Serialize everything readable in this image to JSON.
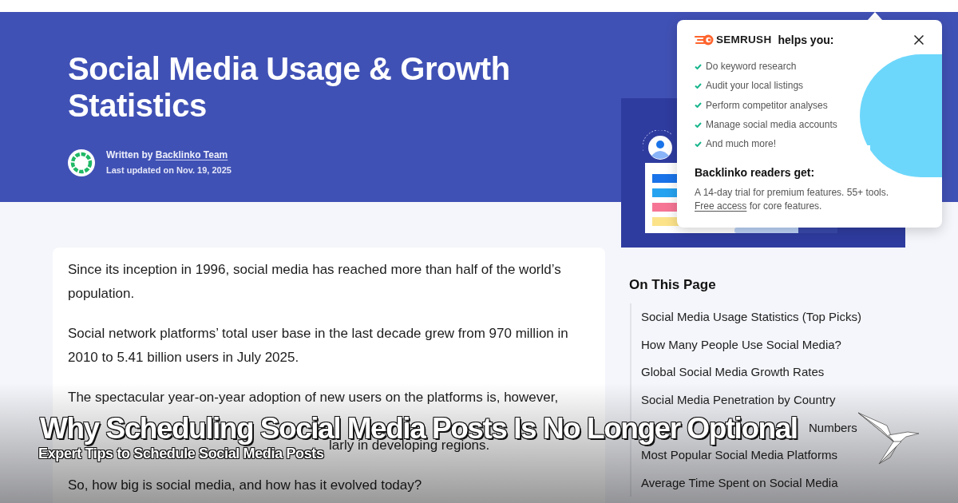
{
  "header": {
    "title": "Social Media Usage & Growth Statistics",
    "byline_label": "Written by",
    "author": "Backlinko Team",
    "updated": "Last updated on Nov. 19, 2025"
  },
  "article": {
    "paragraphs": [
      {
        "kind": "full",
        "text": "Since its inception in 1996, social media has reached more than half of the world’s population."
      },
      {
        "kind": "full",
        "text": "Social network platforms’ total user base in the last decade grew from 970 million in 2010 to 5.41 billion users in July 2025."
      },
      {
        "kind": "covered",
        "lines": [
          "The spectacular year-on-year adoption of new users on the platforms is, however,",
          "larly in developing regions."
        ]
      },
      {
        "kind": "full",
        "text": "So, how big is social media, and how has it evolved today?"
      }
    ]
  },
  "sidebar": {
    "toc_heading": "On This Page",
    "toc_items": [
      {
        "kind": "full",
        "text": "Social Media Usage Statistics (Top Picks)"
      },
      {
        "kind": "full",
        "text": "How Many People Use Social Media?"
      },
      {
        "kind": "full",
        "text": "Global Social Media Growth Rates"
      },
      {
        "kind": "full",
        "text": "Social Media Penetration by Country"
      },
      {
        "kind": "covered",
        "text": "Numbers"
      },
      {
        "kind": "full",
        "text": "Most Popular Social Media Platforms"
      },
      {
        "kind": "full",
        "text": "Average Time Spent on Social Media"
      }
    ]
  },
  "popup": {
    "brand": "SEMRUSH",
    "heading": "helps you:",
    "benefits": [
      "Do keyword research",
      "Audit your local listings",
      "Perform competitor analyses",
      "Manage social media accounts",
      "And much more!"
    ],
    "subheading": "Backlinko readers get:",
    "offer": "A 14-day trial for premium features. 55+ tools.",
    "offer_link": "Free access",
    "offer_tail": "for core features."
  },
  "overlay": {
    "title": "Why Scheduling Social Media Posts Is No Longer Optional",
    "subtitle": "Expert Tips to Schedule Social Media Posts"
  }
}
